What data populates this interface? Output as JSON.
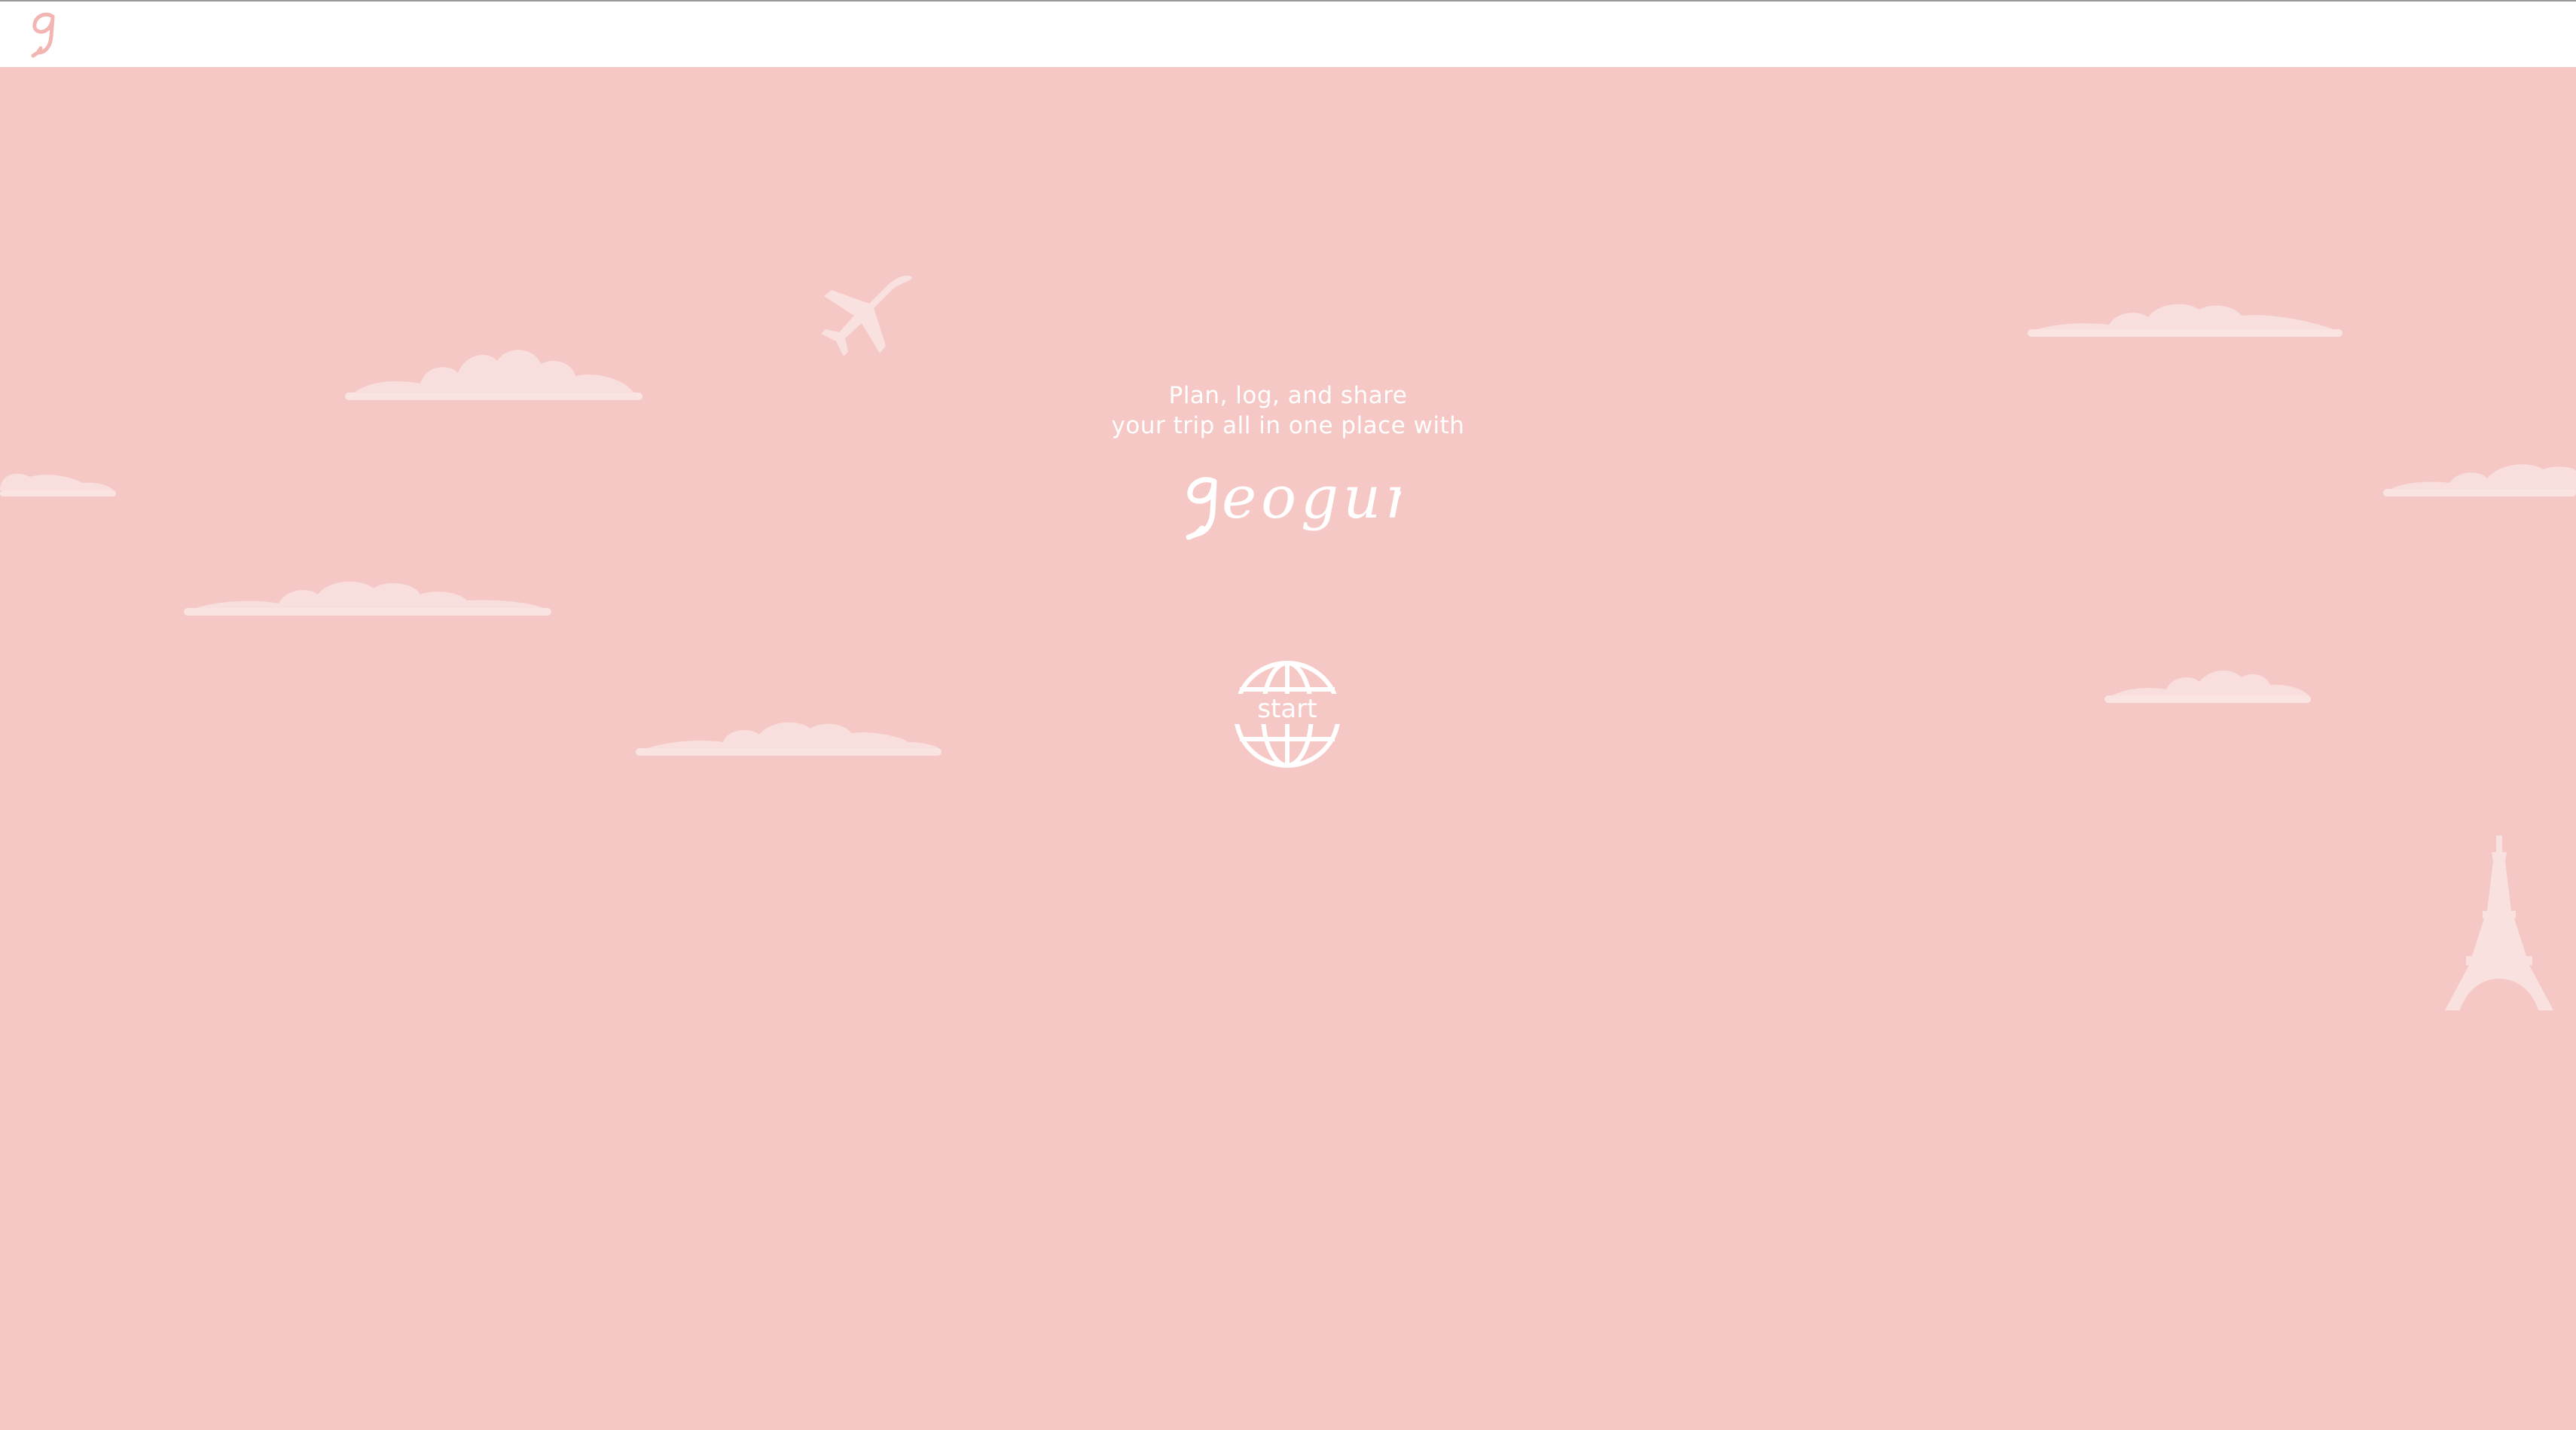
{
  "topbar": {
    "logo_icon": "geoguru-g-logo-icon",
    "logo_color": "#f2b5b2"
  },
  "hero": {
    "background_color": "#f5c8c5",
    "tagline_line1": "Plan, log, and share",
    "tagline_line2": "your trip all in one place with",
    "brand_name": "Geoguru",
    "start_label": "start",
    "start_icon": "globe-icon",
    "decorations": [
      "cloud-icon",
      "airplane-icon",
      "eiffel-tower-icon"
    ]
  }
}
